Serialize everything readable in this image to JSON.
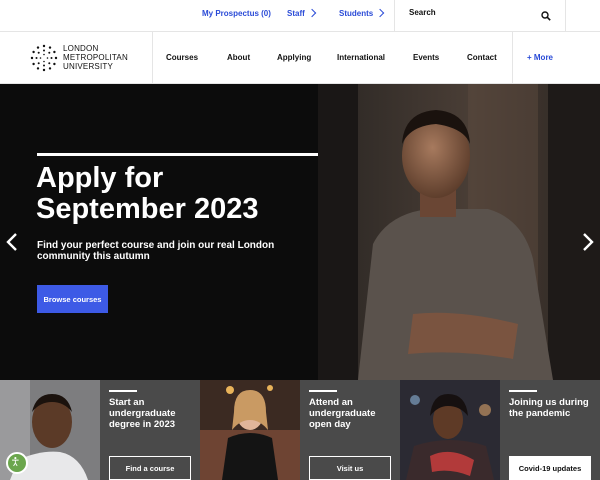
{
  "topbar": {
    "prospectus": "My Prospectus (0)",
    "staff": "Staff",
    "students": "Students",
    "search_placeholder": "Search"
  },
  "logo": {
    "line1": "LONDON",
    "line2": "METROPOLITAN",
    "line3": "UNIVERSITY"
  },
  "nav": {
    "items": [
      "Courses",
      "About",
      "Applying",
      "International",
      "Events",
      "Contact"
    ],
    "more": "+ More"
  },
  "hero": {
    "title_line1": "Apply for",
    "title_line2": "September 2023",
    "subtitle": "Find your perfect course and join our real London community this autumn",
    "button": "Browse courses"
  },
  "tiles": [
    {
      "text": "Start an undergraduate degree in 2023",
      "button": "Find a course"
    },
    {
      "text": "Attend an undergraduate open day",
      "button": "Visit us"
    },
    {
      "text": "Joining us during the pandemic",
      "button": "Covid-19 updates"
    }
  ],
  "colors": {
    "accent": "#2a4bd7",
    "button": "#3d5ae6",
    "card": "#4a4a4a",
    "accessibility": "#6ba64d"
  }
}
